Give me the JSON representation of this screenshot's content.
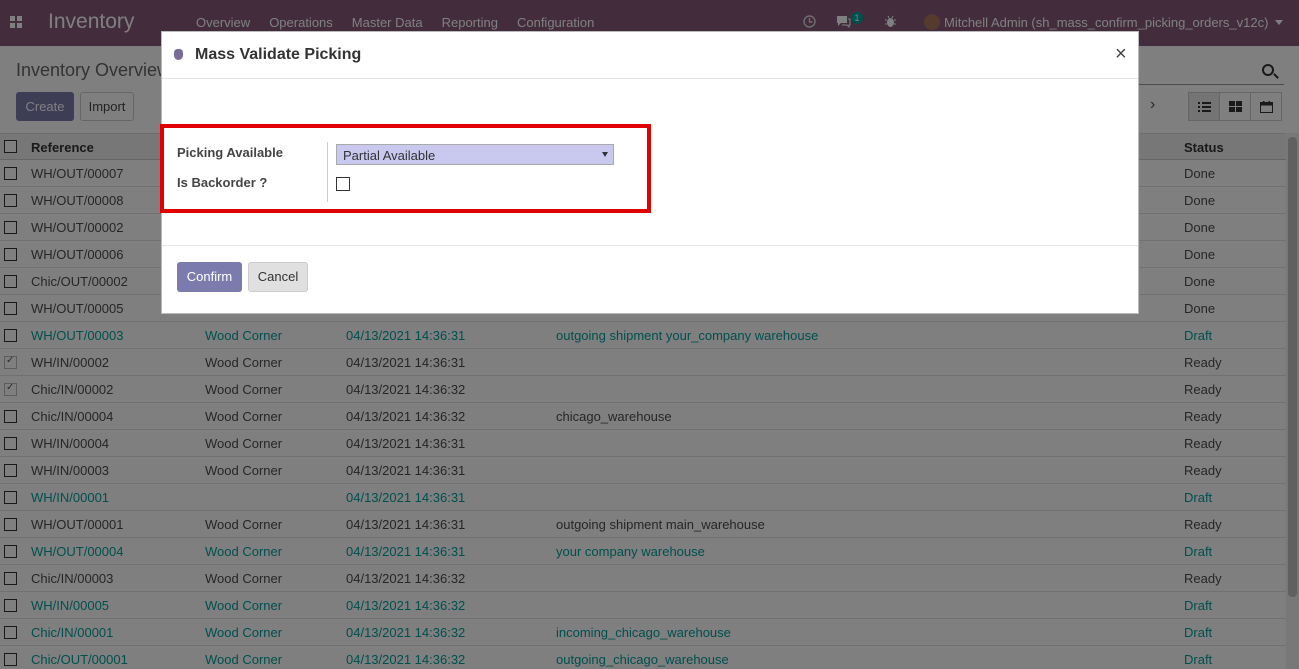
{
  "navbar": {
    "app_title": "Inventory",
    "menu": [
      "Overview",
      "Operations",
      "Master Data",
      "Reporting",
      "Configuration"
    ],
    "messages_count": "1",
    "user_label": "Mitchell Admin (sh_mass_confirm_picking_orders_v12c)",
    "color": "#875a7b"
  },
  "control_panel": {
    "title": "Inventory Overview",
    "create_label": "Create",
    "import_label": "Import"
  },
  "list": {
    "headers": {
      "reference": "Reference",
      "status": "Status"
    },
    "rows": [
      {
        "reference": "WH/OUT/00007",
        "contact": "",
        "date": "",
        "source": "",
        "status": "Done",
        "checked": false,
        "draft": false
      },
      {
        "reference": "WH/OUT/00008",
        "contact": "",
        "date": "",
        "source": "",
        "status": "Done",
        "checked": false,
        "draft": false
      },
      {
        "reference": "WH/OUT/00002",
        "contact": "",
        "date": "",
        "source": "",
        "status": "Done",
        "checked": false,
        "draft": false
      },
      {
        "reference": "WH/OUT/00006",
        "contact": "",
        "date": "",
        "source": "",
        "status": "Done",
        "checked": false,
        "draft": false
      },
      {
        "reference": "Chic/OUT/00002",
        "contact": "",
        "date": "",
        "source": "",
        "status": "Done",
        "checked": false,
        "draft": false
      },
      {
        "reference": "WH/OUT/00005",
        "contact": "",
        "date": "",
        "source": "",
        "status": "Done",
        "checked": false,
        "draft": false
      },
      {
        "reference": "WH/OUT/00003",
        "contact": "Wood Corner",
        "date": "04/13/2021 14:36:31",
        "source": "outgoing shipment your_company warehouse",
        "status": "Draft",
        "checked": false,
        "draft": true
      },
      {
        "reference": "WH/IN/00002",
        "contact": "Wood Corner",
        "date": "04/13/2021 14:36:31",
        "source": "",
        "status": "Ready",
        "checked": true,
        "draft": false
      },
      {
        "reference": "Chic/IN/00002",
        "contact": "Wood Corner",
        "date": "04/13/2021 14:36:32",
        "source": "",
        "status": "Ready",
        "checked": true,
        "draft": false
      },
      {
        "reference": "Chic/IN/00004",
        "contact": "Wood Corner",
        "date": "04/13/2021 14:36:32",
        "source": "chicago_warehouse",
        "status": "Ready",
        "checked": false,
        "draft": false
      },
      {
        "reference": "WH/IN/00004",
        "contact": "Wood Corner",
        "date": "04/13/2021 14:36:31",
        "source": "",
        "status": "Ready",
        "checked": false,
        "draft": false
      },
      {
        "reference": "WH/IN/00003",
        "contact": "Wood Corner",
        "date": "04/13/2021 14:36:31",
        "source": "",
        "status": "Ready",
        "checked": false,
        "draft": false
      },
      {
        "reference": "WH/IN/00001",
        "contact": "",
        "date": "04/13/2021 14:36:31",
        "source": "",
        "status": "Draft",
        "checked": false,
        "draft": true
      },
      {
        "reference": "WH/OUT/00001",
        "contact": "Wood Corner",
        "date": "04/13/2021 14:36:31",
        "source": "outgoing shipment main_warehouse",
        "status": "Ready",
        "checked": false,
        "draft": false
      },
      {
        "reference": "WH/OUT/00004",
        "contact": "Wood Corner",
        "date": "04/13/2021 14:36:31",
        "source": "your company warehouse",
        "status": "Draft",
        "checked": false,
        "draft": true
      },
      {
        "reference": "Chic/IN/00003",
        "contact": "Wood Corner",
        "date": "04/13/2021 14:36:32",
        "source": "",
        "status": "Ready",
        "checked": false,
        "draft": false
      },
      {
        "reference": "WH/IN/00005",
        "contact": "Wood Corner",
        "date": "04/13/2021 14:36:32",
        "source": "",
        "status": "Draft",
        "checked": false,
        "draft": true
      },
      {
        "reference": "Chic/IN/00001",
        "contact": "Wood Corner",
        "date": "04/13/2021 14:36:32",
        "source": "incoming_chicago_warehouse",
        "status": "Draft",
        "checked": false,
        "draft": true
      },
      {
        "reference": "Chic/OUT/00001",
        "contact": "Wood Corner",
        "date": "04/13/2021 14:36:32",
        "source": "outgoing_chicago_warehouse",
        "status": "Draft",
        "checked": false,
        "draft": true
      }
    ]
  },
  "modal": {
    "title": "Mass Validate Picking",
    "close_symbol": "×",
    "picking_available_label": "Picking Available",
    "picking_available_value": "Partial Available",
    "is_backorder_label": "Is Backorder ?",
    "is_backorder_checked": false,
    "confirm_label": "Confirm",
    "cancel_label": "Cancel",
    "highlight_color": "#e00000"
  }
}
